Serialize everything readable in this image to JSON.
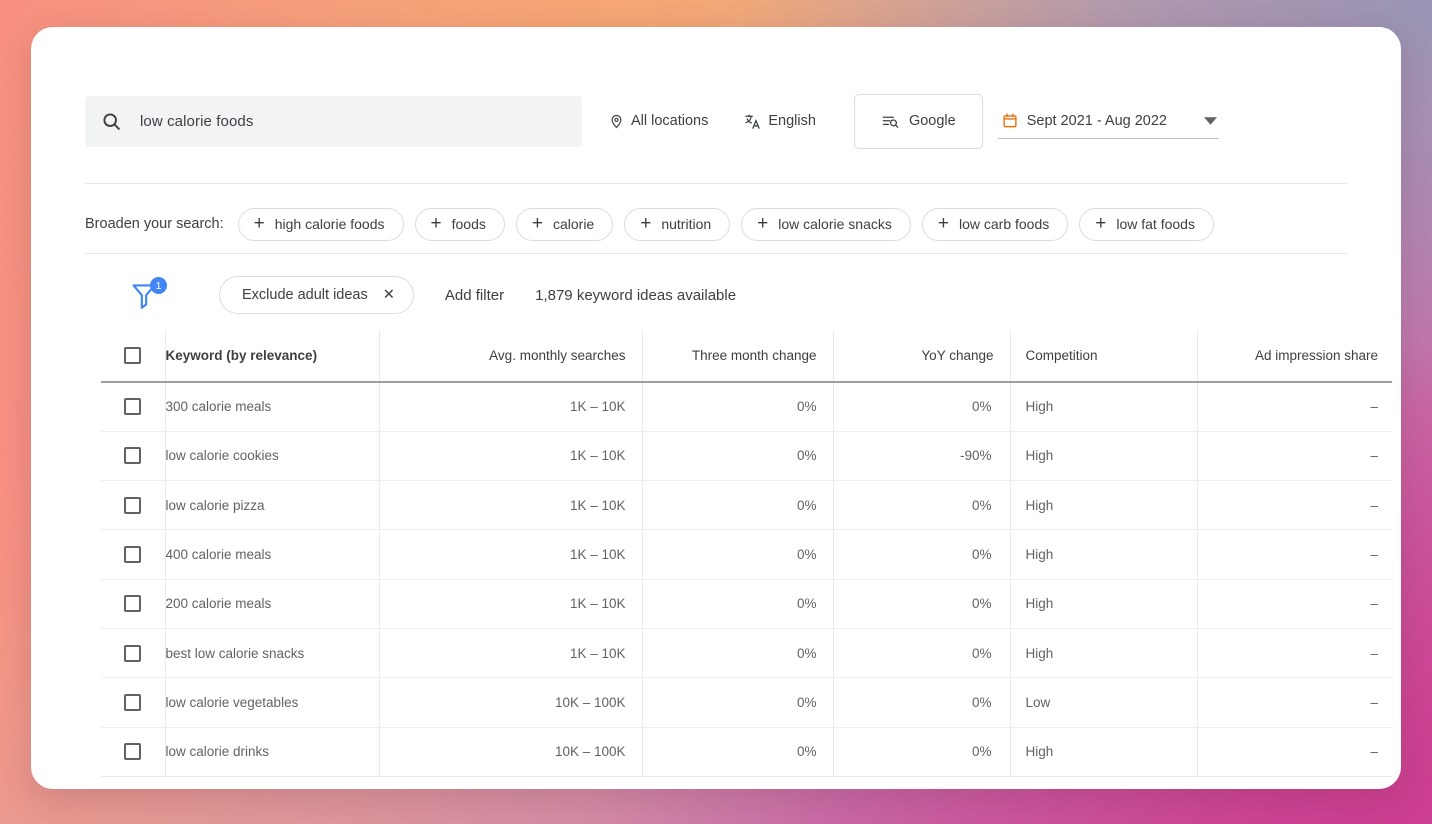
{
  "search": {
    "icon": "search-icon",
    "value": "low calorie foods",
    "placeholder": "Enter a keyword"
  },
  "toolbar": {
    "location": {
      "icon": "location-pin-icon",
      "label": "All locations"
    },
    "language": {
      "icon": "translate-icon",
      "label": "English"
    },
    "network": {
      "icon": "search-network-icon",
      "label": "Google"
    },
    "date": {
      "icon": "calendar-icon",
      "label": "Sept 2021 - Aug 2022",
      "caret": "chevron-down-icon"
    }
  },
  "broaden": {
    "label": "Broaden your search:",
    "plus": "+",
    "chips": [
      "high calorie foods",
      "foods",
      "calorie",
      "nutrition",
      "low calorie snacks",
      "low carb foods",
      "low fat foods"
    ]
  },
  "filters": {
    "icon": "filter-funnel-icon",
    "badge": "1",
    "active_chip": {
      "label": "Exclude adult ideas",
      "remove": "✕"
    },
    "add_filter": "Add filter",
    "ideas_available": "1,879 keyword ideas available",
    "accent_color": "#4285f4"
  },
  "table": {
    "columns": [
      "Keyword (by relevance)",
      "Avg. monthly searches",
      "Three month change",
      "YoY change",
      "Competition",
      "Ad impression share"
    ],
    "rows": [
      {
        "keyword": "300 calorie meals",
        "avg": "1K – 10K",
        "three_month": "0%",
        "yoy": "0%",
        "competition": "High",
        "ad_share": "–"
      },
      {
        "keyword": "low calorie cookies",
        "avg": "1K – 10K",
        "three_month": "0%",
        "yoy": "-90%",
        "competition": "High",
        "ad_share": "–"
      },
      {
        "keyword": "low calorie pizza",
        "avg": "1K – 10K",
        "three_month": "0%",
        "yoy": "0%",
        "competition": "High",
        "ad_share": "–"
      },
      {
        "keyword": "400 calorie meals",
        "avg": "1K – 10K",
        "three_month": "0%",
        "yoy": "0%",
        "competition": "High",
        "ad_share": "–"
      },
      {
        "keyword": "200 calorie meals",
        "avg": "1K – 10K",
        "three_month": "0%",
        "yoy": "0%",
        "competition": "High",
        "ad_share": "–"
      },
      {
        "keyword": "best low calorie snacks",
        "avg": "1K – 10K",
        "three_month": "0%",
        "yoy": "0%",
        "competition": "High",
        "ad_share": "–"
      },
      {
        "keyword": "low calorie vegetables",
        "avg": "10K – 100K",
        "three_month": "0%",
        "yoy": "0%",
        "competition": "Low",
        "ad_share": "–"
      },
      {
        "keyword": "low calorie drinks",
        "avg": "10K – 100K",
        "three_month": "0%",
        "yoy": "0%",
        "competition": "High",
        "ad_share": "–"
      }
    ]
  }
}
